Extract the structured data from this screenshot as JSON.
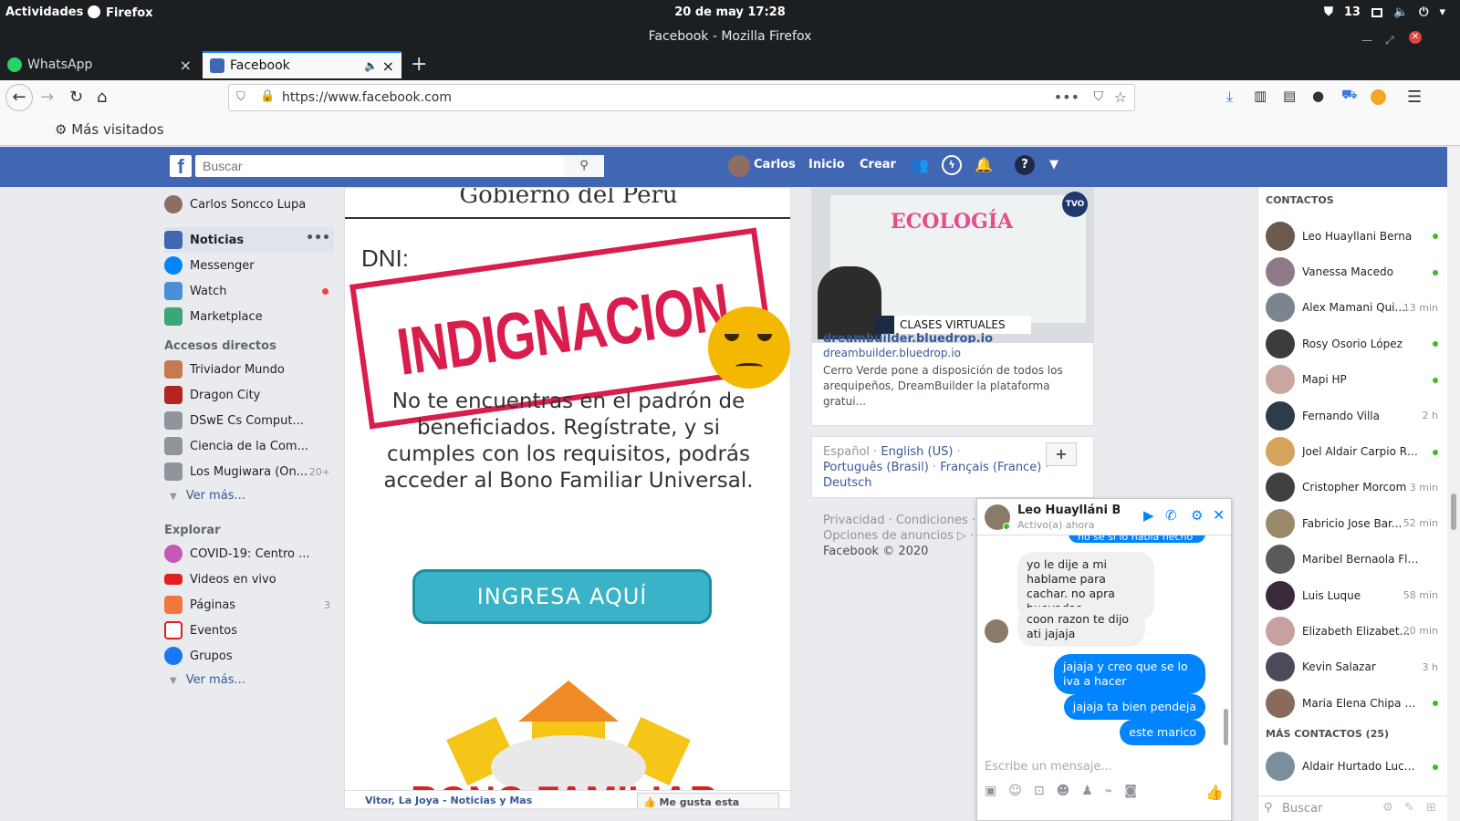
{
  "gnome": {
    "activities": "Actividades",
    "app": "Firefox",
    "clock": "20 de may  17:28",
    "updates": "13"
  },
  "window_title": "Facebook - Mozilla Firefox",
  "tabs": [
    {
      "label": "WhatsApp"
    },
    {
      "label": "Facebook"
    }
  ],
  "url": "https://www.facebook.com",
  "bookmarks": {
    "most_visited": "Más visitados"
  },
  "fb": {
    "search_placeholder": "Buscar",
    "user": "Carlos",
    "nav_home": "Inicio",
    "nav_create": "Crear",
    "profile": "Carlos Soncco Lupa",
    "menu": [
      {
        "label": "Noticias",
        "color": "#4267b2"
      },
      {
        "label": "Messenger",
        "color": "#0084ff"
      },
      {
        "label": "Watch",
        "color": "#4a90d9"
      },
      {
        "label": "Marketplace",
        "color": "#3aa776"
      }
    ],
    "shortcuts_title": "Accesos directos",
    "shortcuts": [
      {
        "label": "Triviador Mundo",
        "badge": ""
      },
      {
        "label": "Dragon City",
        "badge": ""
      },
      {
        "label": "DSwE Cs Comput...",
        "badge": ""
      },
      {
        "label": "Ciencia de la Com...",
        "badge": ""
      },
      {
        "label": "Los Mugiwara (On...",
        "badge": "20+"
      }
    ],
    "see_more": "Ver más...",
    "explore_title": "Explorar",
    "explore": [
      {
        "label": "COVID-19: Centro ...",
        "badge": ""
      },
      {
        "label": "Videos en vivo",
        "badge": ""
      },
      {
        "label": "Páginas",
        "badge": "3"
      },
      {
        "label": "Eventos",
        "badge": ""
      },
      {
        "label": "Grupos",
        "badge": ""
      }
    ]
  },
  "post": {
    "header": "Gobierno del Perú",
    "dni": "DNI:",
    "stamp": "INDIGNACION",
    "body": "No te encuentras en el padrón de beneficiados. Regístrate, y si cumples con los requisitos, podrás acceder al Bono Familiar Universal.",
    "button": "INGRESA AQUÍ",
    "bottom": "BONO FAMILIAR",
    "footer_links": "Vitor, La Joya - Noticias y Mas",
    "like_page": "Me gusta esta página"
  },
  "ad": {
    "video_caption": "CLASES VIRTUALES",
    "video_title": "ECOLOGÍA",
    "badge": "TVO",
    "domain": "dreambuilder.bluedrop.io",
    "domain2": "dreambuilder.bluedrop.io",
    "text": "Cerro Verde pone a disposición de todos los arequipeños, DreamBuilder la plataforma gratui..."
  },
  "languages": {
    "l1": "Español",
    "l2": "English (US)",
    "l3": "Português (Brasil)",
    "l4": "Français (France)",
    "l5": "Deutsch",
    "add": "+"
  },
  "footer": {
    "line1": "Privacidad · Condiciones · Pu",
    "line2": "Opciones de anuncios ▷ · Co",
    "copy": "Facebook © 2020"
  },
  "contacts_title": "CONTACTOS",
  "contacts": [
    {
      "name": "Leo Huayllani Berna",
      "status": "online"
    },
    {
      "name": "Vanessa Macedo",
      "status": "online"
    },
    {
      "name": "Alex Mamani Qui...",
      "status": "13 min"
    },
    {
      "name": "Rosy Osorio López",
      "status": "online"
    },
    {
      "name": "Mapi HP",
      "status": "online"
    },
    {
      "name": "Fernando Villa",
      "status": "2 h"
    },
    {
      "name": "Joel Aldair Carpio Ra...",
      "status": "online"
    },
    {
      "name": "Cristopher Morcom",
      "status": "3 min"
    },
    {
      "name": "Fabricio Jose Bar...",
      "status": "52 min"
    },
    {
      "name": "Maribel Bernaola Flores",
      "status": ""
    },
    {
      "name": "Luis Luque",
      "status": "58 min"
    },
    {
      "name": "Elizabeth Elizabet...",
      "status": "20 min"
    },
    {
      "name": "Kevin Salazar",
      "status": "3 h"
    },
    {
      "name": "Maria Elena Chipa Ve...",
      "status": "online"
    }
  ],
  "more_contacts": "MÁS CONTACTOS (25)",
  "more_contact": {
    "name": "Aldair Hurtado Lucana",
    "status": "online"
  },
  "contacts_search": "Buscar",
  "chat": {
    "name": "Leo Huaylláni B...",
    "status": "Activo(a) ahora",
    "partial": "no se si lo habia hecho",
    "m1": "yo le dije a mi hablame para cachar. no apra huevadas",
    "m2": "coon razon te dijo ati jajaja",
    "m3": "jajaja y creo que se lo iva a hacer",
    "m4": "jajaja ta bien pendeja",
    "m5": "este marico",
    "input_placeholder": "Escribe un mensaje..."
  }
}
